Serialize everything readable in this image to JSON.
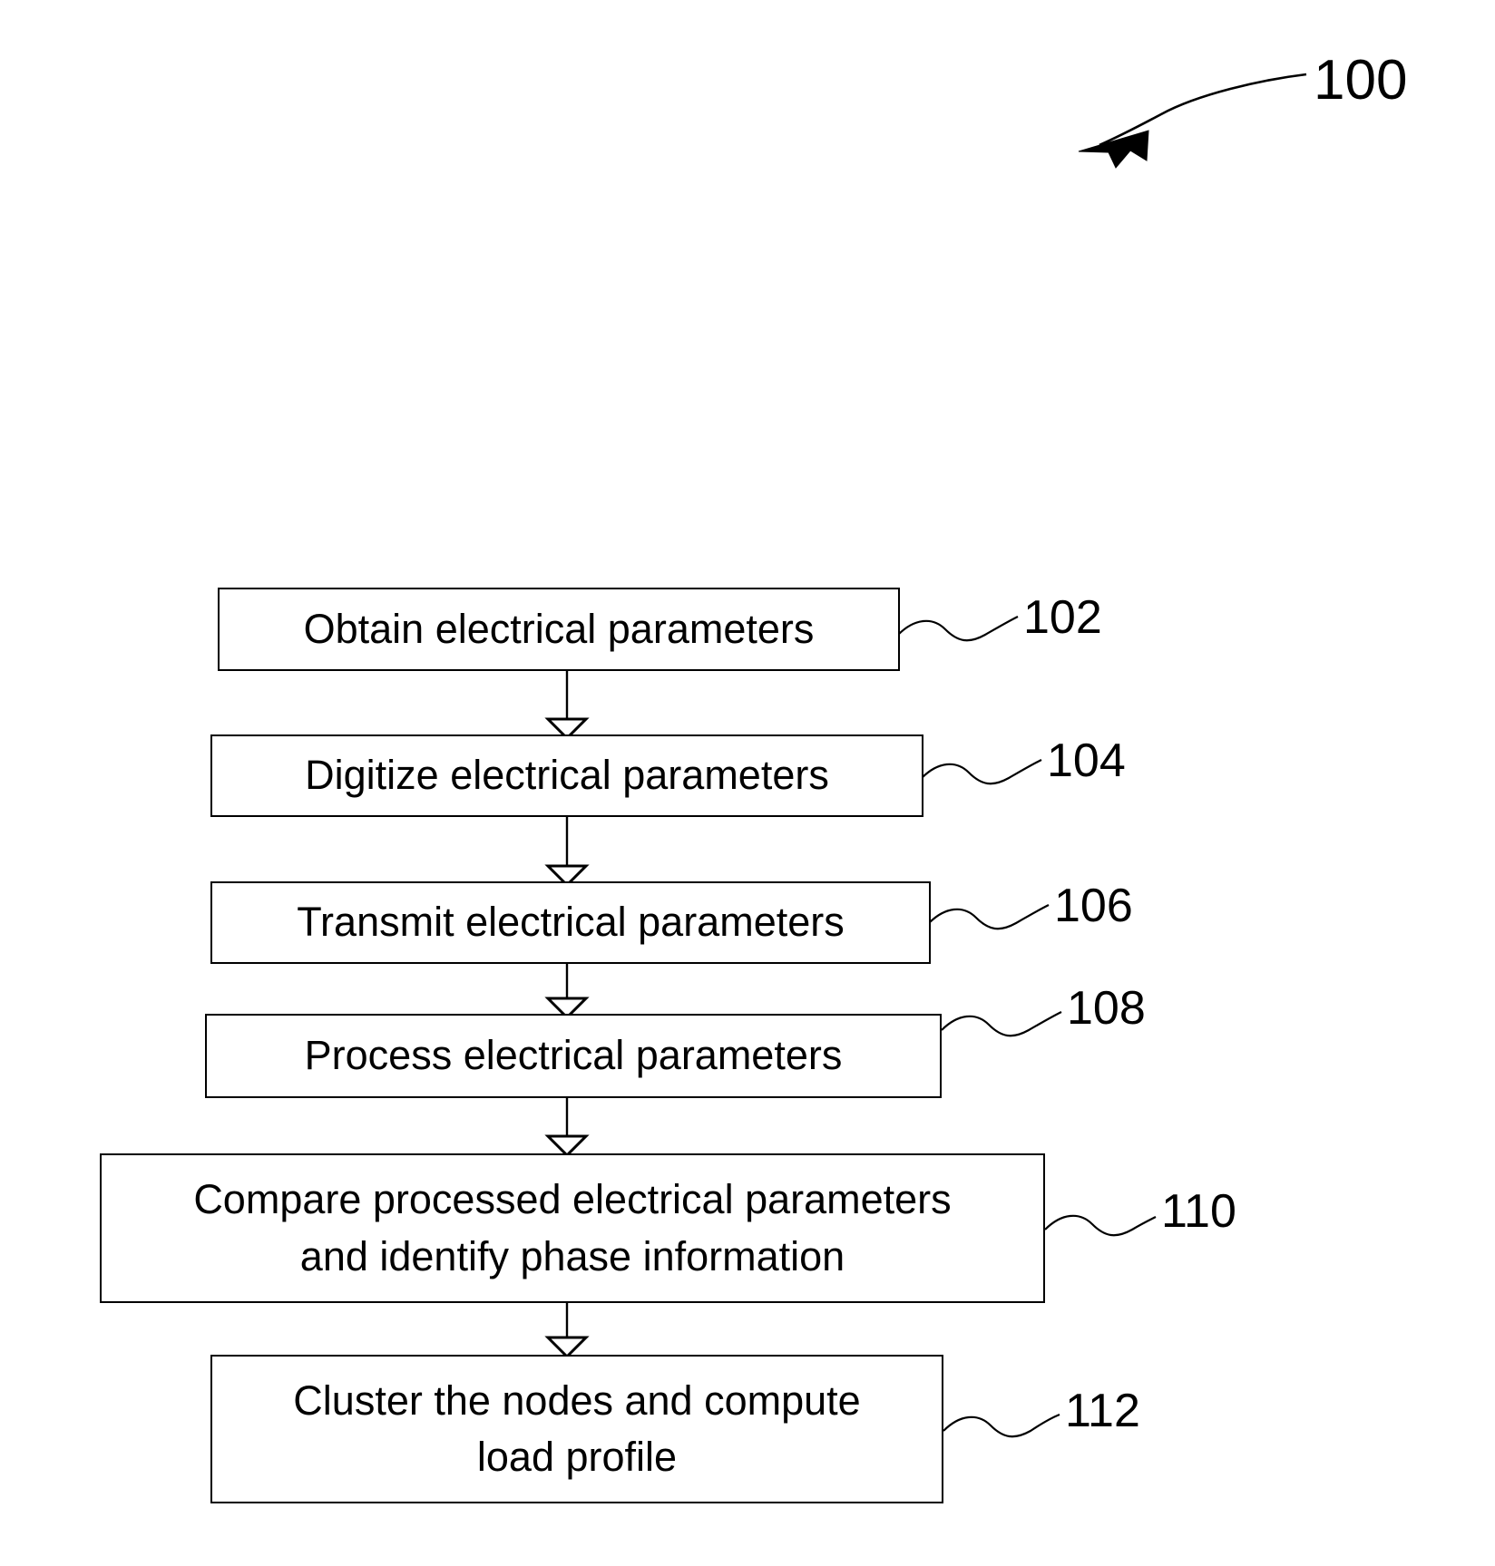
{
  "figure": {
    "label": "100",
    "label_name": "figure-reference-100"
  },
  "diagram": {
    "type": "flowchart",
    "orientation": "vertical",
    "background_color": "#ffffff",
    "line_color": "#000000",
    "arrow_style": "hollow-triangle",
    "steps": [
      {
        "ref": "102",
        "text": "Obtain electrical parameters",
        "lines": [
          "Obtain electrical parameters"
        ]
      },
      {
        "ref": "104",
        "text": "Digitize electrical parameters",
        "lines": [
          "Digitize electrical parameters"
        ]
      },
      {
        "ref": "106",
        "text": "Transmit electrical parameters",
        "lines": [
          "Transmit electrical parameters"
        ]
      },
      {
        "ref": "108",
        "text": "Process electrical parameters",
        "lines": [
          "Process electrical parameters"
        ]
      },
      {
        "ref": "110",
        "text": "Compare processed electrical parameters\nand identify phase information",
        "lines": [
          "Compare processed electrical parameters",
          "and identify phase information"
        ]
      },
      {
        "ref": "112",
        "text": "Cluster the nodes and compute\nload profile",
        "lines": [
          "Cluster the nodes and compute",
          "load profile"
        ]
      }
    ]
  }
}
